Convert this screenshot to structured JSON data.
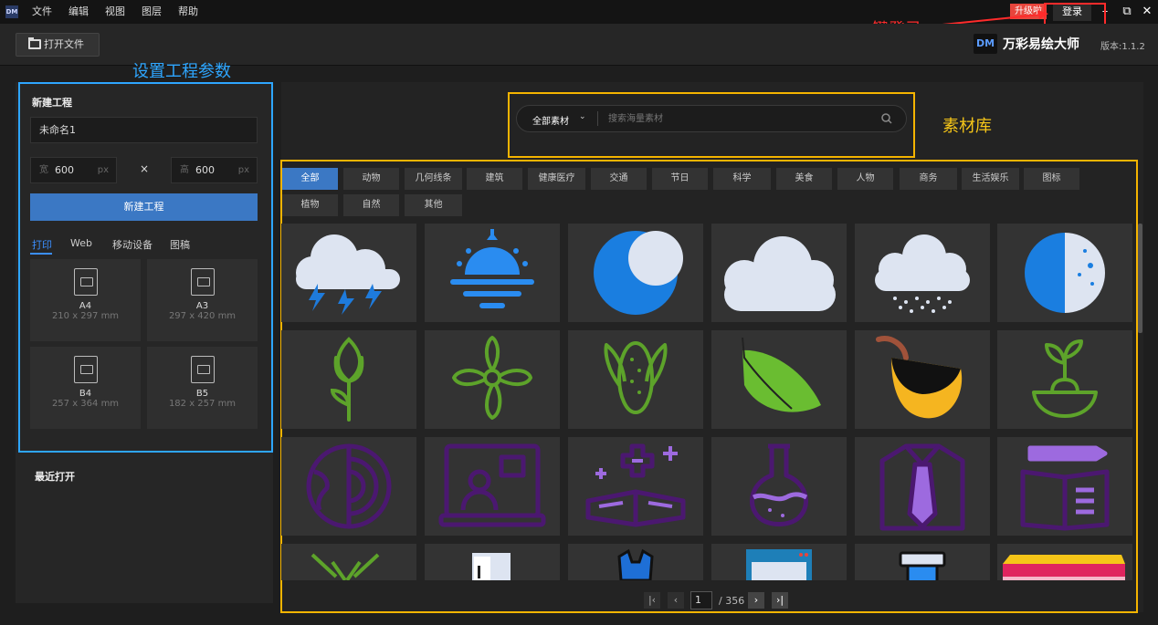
{
  "app": {
    "logo_text": "DM",
    "brand_name": "万彩易绘大师",
    "version": "版本:1.1.2"
  },
  "menu": [
    "文件",
    "编辑",
    "视图",
    "图层",
    "帮助"
  ],
  "titlebar": {
    "upgrade_label": "升级啦",
    "login_label": "登录"
  },
  "toolbar": {
    "open_file_label": "打开文件"
  },
  "annotations": {
    "one_click_login": "一键登录",
    "project_params": "设置工程参数",
    "library": "素材库"
  },
  "new_project": {
    "title": "新建工程",
    "name_value": "未命名1",
    "width_label": "宽",
    "width_value": "600",
    "height_label": "高",
    "height_value": "600",
    "unit": "px",
    "times": "×",
    "create_button": "新建工程",
    "tabs": [
      "打印",
      "Web",
      "移动设备",
      "图稿"
    ],
    "papers": [
      {
        "name": "A4",
        "size": "210 x 297 mm"
      },
      {
        "name": "A3",
        "size": "297 x 420 mm"
      },
      {
        "name": "B4",
        "size": "257 x 364 mm"
      },
      {
        "name": "B5",
        "size": "182 x 257 mm"
      }
    ]
  },
  "recent": {
    "title": "最近打开"
  },
  "search": {
    "scope": "全部素材",
    "placeholder": "搜索海量素材"
  },
  "categories": [
    "全部",
    "动物",
    "几何线条",
    "建筑",
    "健康医疗",
    "交通",
    "节日",
    "科学",
    "美食",
    "人物",
    "商务",
    "生活娱乐",
    "图标",
    "植物",
    "自然",
    "其他"
  ],
  "pager": {
    "current": "1",
    "total": "/ 356"
  },
  "colors": {
    "accent": "#3b78c4",
    "annot_red": "#ff2b2b",
    "annot_blue": "#2ea6ff",
    "annot_yellow": "#f5b400"
  },
  "tiles": [
    "thunderstorm-cloud-icon",
    "sunrise-icon",
    "crescent-moon-icon",
    "cloud-icon",
    "rain-cloud-icon",
    "half-moon-icon",
    "tulip-icon",
    "flower-icon",
    "corn-icon",
    "leaf-icon",
    "acorn-icon",
    "sprout-bowl-icon",
    "earth-globe-icon",
    "online-teacher-icon",
    "medical-book-icon",
    "flask-icon",
    "shirt-tie-icon",
    "book-pencil-icon",
    "herb-icon",
    "refrigerator-icon",
    "clothes-icon",
    "browser-window-icon",
    "paint-brush-icon",
    "eraser-icon"
  ]
}
